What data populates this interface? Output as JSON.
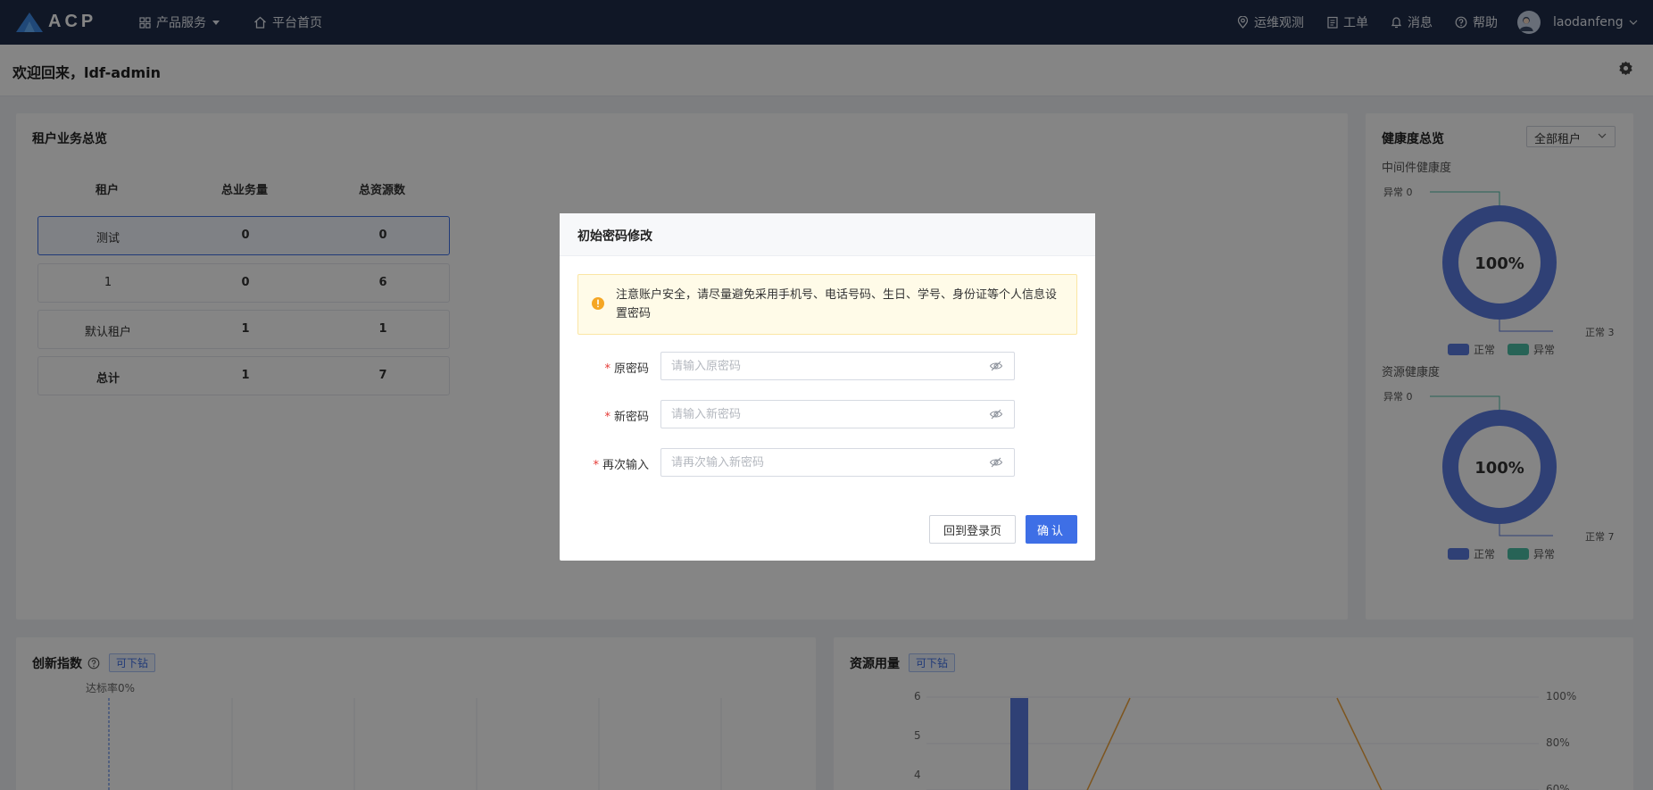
{
  "nav": {
    "logo": "ACP",
    "products": "产品服务",
    "home": "平台首页",
    "ops": "运维观测",
    "ticket": "工单",
    "messages": "消息",
    "help": "帮助",
    "username": "laodanfeng"
  },
  "header": {
    "welcome": "欢迎回来，ldf-admin"
  },
  "tenant_overview": {
    "title": "租户业务总览",
    "columns": [
      "租户",
      "总业务量",
      "总资源数"
    ],
    "rows": [
      {
        "tenant": "测试",
        "business": "0",
        "resources": "0"
      },
      {
        "tenant": "1",
        "business": "0",
        "resources": "6"
      },
      {
        "tenant": "默认租户",
        "business": "1",
        "resources": "1"
      },
      {
        "tenant": "总计",
        "business": "1",
        "resources": "7"
      }
    ]
  },
  "health": {
    "title": "健康度总览",
    "filter": "全部租户",
    "middleware": {
      "title": "中间件健康度",
      "abnormal_label": "异常 0",
      "normal_label": "正常 3",
      "percent": "100%"
    },
    "resource": {
      "title": "资源健康度",
      "abnormal_label": "异常 0",
      "normal_label": "正常 7",
      "percent": "100%"
    },
    "legend_normal": "正常",
    "legend_abnormal": "异常",
    "colors": {
      "normal": "#5b7be0",
      "abnormal": "#4cbfa6"
    }
  },
  "innovation": {
    "title": "创新指数",
    "tag": "可下钻",
    "rate_label": "达标率0%"
  },
  "usage": {
    "title": "资源用量",
    "tag": "可下钻",
    "y_left": [
      "6",
      "5",
      "4"
    ],
    "y_right": [
      "100%",
      "80%",
      "60%"
    ]
  },
  "chart_data": {
    "type": "bar",
    "title": "资源用量",
    "series": [
      {
        "values": [
          6
        ]
      }
    ],
    "y_left_ticks": [
      6,
      5,
      4
    ],
    "y_right_ticks": [
      "100%",
      "80%",
      "60%"
    ]
  },
  "modal": {
    "title": "初始密码修改",
    "alert": "注意账户安全，请尽量避免采用手机号、电话号码、生日、学号、身份证等个人信息设置密码",
    "fields": [
      {
        "label": "原密码",
        "placeholder": "请输入原密码"
      },
      {
        "label": "新密码",
        "placeholder": "请输入新密码"
      },
      {
        "label": "再次输入",
        "placeholder": "请再次输入新密码"
      }
    ],
    "back_button": "回到登录页",
    "confirm_button": "确认"
  }
}
